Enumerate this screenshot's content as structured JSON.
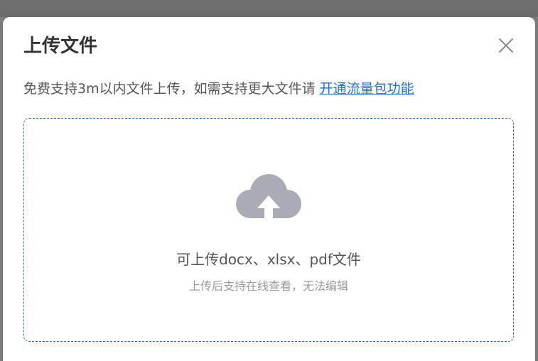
{
  "dialog": {
    "title": "上传文件",
    "notice": "免费支持3m以内文件上传，如需支持更大文件请 ",
    "notice_link": "开通流量包功能",
    "close_icon": "close-icon"
  },
  "upload": {
    "icon": "cloud-upload-icon",
    "main_text": "可上传docx、xlsx、pdf文件",
    "sub_text": "上传后支持在线查看，无法编辑"
  },
  "colors": {
    "link": "#1a6fd6",
    "dashed_border": "#2c6cc7",
    "cloud_icon": "#a9acb4"
  }
}
